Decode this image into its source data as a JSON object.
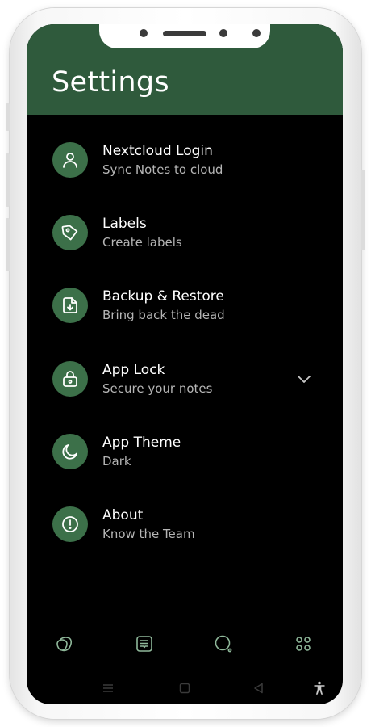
{
  "header": {
    "title": "Settings"
  },
  "settings": [
    {
      "title": "Nextcloud Login",
      "subtitle": "Sync Notes to cloud",
      "icon": "user-icon"
    },
    {
      "title": "Labels",
      "subtitle": "Create labels",
      "icon": "tag-icon"
    },
    {
      "title": "Backup & Restore",
      "subtitle": "Bring back the dead",
      "icon": "backup-icon"
    },
    {
      "title": "App Lock",
      "subtitle": "Secure your notes",
      "icon": "lock-icon",
      "expandable": true
    },
    {
      "title": "App Theme",
      "subtitle": "Dark",
      "icon": "moon-icon"
    },
    {
      "title": "About",
      "subtitle": "Know the Team",
      "icon": "info-icon"
    }
  ],
  "bottom_nav": [
    "notes-stack-icon",
    "archive-icon",
    "search-icon",
    "apps-grid-icon"
  ],
  "system_nav": [
    "menu-icon",
    "home-square-icon",
    "back-triangle-icon",
    "accessibility-icon"
  ],
  "colors": {
    "header_bg": "#2f5a3c",
    "icon_circle": "#3c7049",
    "screen_bg": "#000000",
    "nav_icon": "#8fb89a",
    "subtitle": "#b5b5b5"
  }
}
